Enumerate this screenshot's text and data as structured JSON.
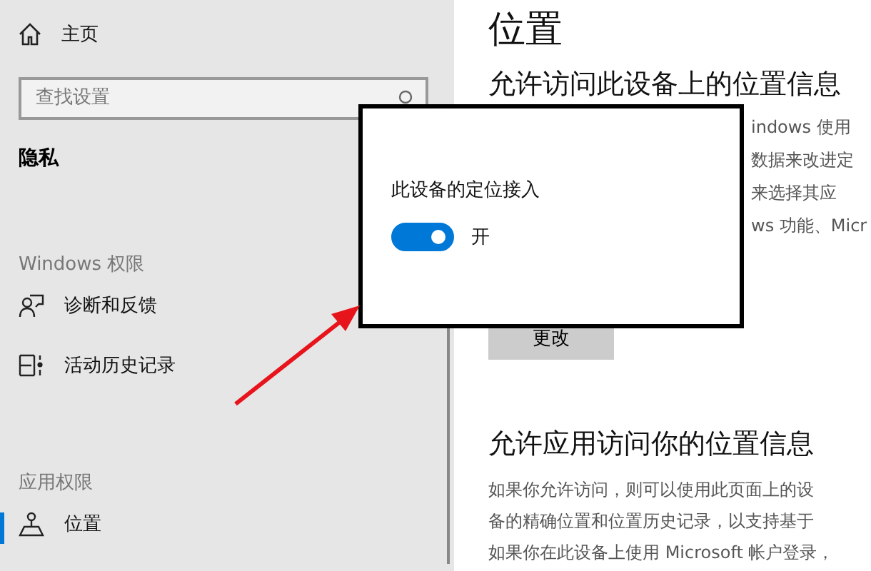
{
  "sidebar": {
    "home": {
      "label": "主页"
    },
    "search": {
      "placeholder": "查找设置"
    },
    "section_title": "隐私",
    "groups": [
      {
        "title": "Windows 权限",
        "items": [
          {
            "label": "诊断和反馈",
            "kind": "feedback",
            "selected": false
          },
          {
            "label": "活动历史记录",
            "kind": "timeline",
            "selected": false
          }
        ]
      },
      {
        "title": "应用权限",
        "items": [
          {
            "label": "位置",
            "kind": "location",
            "selected": true
          }
        ]
      }
    ]
  },
  "content": {
    "title": "位置",
    "section1": {
      "heading": "允许访问此设备上的位置信息",
      "text_lines": [
        "indows 使用",
        "数据来改进定",
        "来选择其应",
        "ws 功能、Micr"
      ],
      "button": "更改"
    },
    "section2": {
      "heading": "允许应用访问你的位置信息",
      "text_lines": [
        "如果你允许访问，则可以使用此页面上的设",
        "备的精确位置和位置历史记录，以支持基于",
        "如果你在此设备上使用 Microsoft 帐户登录，"
      ]
    }
  },
  "popup": {
    "label": "此设备的定位接入",
    "toggle": {
      "on": true,
      "label": "开"
    }
  }
}
